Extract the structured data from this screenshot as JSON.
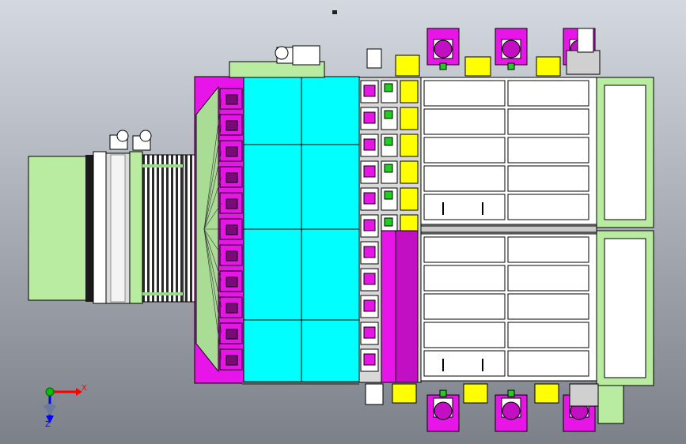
{
  "viewport": {
    "background_top": "#d4d8df",
    "background_bottom": "#7c8089"
  },
  "colors": {
    "green_housing": "#b9eba1",
    "magenta": "#e815e8",
    "cyan": "#00ffff",
    "yellow": "#ffff00",
    "white_panel": "#ffffff",
    "gray_part": "#c8c8c8",
    "dark_line": "#000000",
    "axis_x": "#ff0000",
    "axis_y": "#00c000",
    "axis_z": "#0000ff"
  },
  "triad": {
    "x_label": "X",
    "z_label": "Z"
  }
}
